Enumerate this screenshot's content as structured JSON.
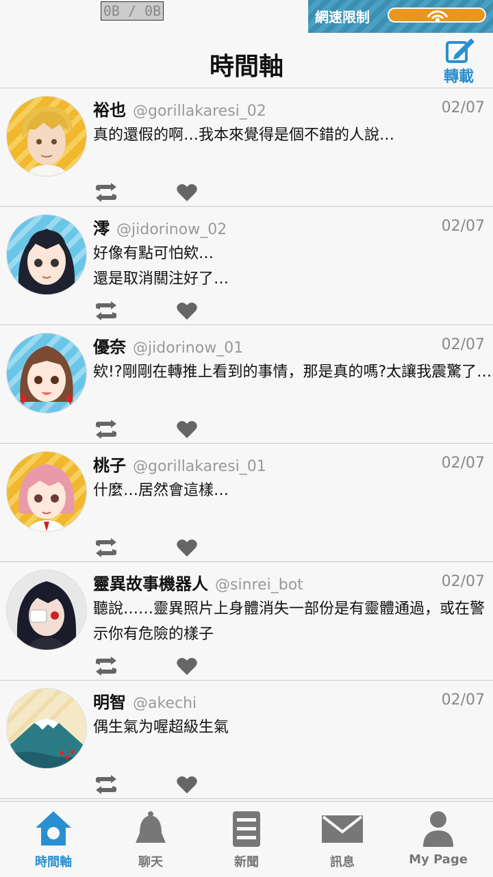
{
  "status": {
    "counter": "0B / 0B",
    "net_limit_label": "網速限制"
  },
  "header": {
    "title": "時間軸",
    "repost_label": "轉載"
  },
  "posts": [
    {
      "name": "裕也",
      "handle": "@gorillakaresi_02",
      "date": "02/07",
      "text": "真的還假的啊…我本來覺得是個不錯的人說…"
    },
    {
      "name": "澪",
      "handle": "@jidorinow_02",
      "date": "02/07",
      "text": "好像有點可怕欸…\n還是取消關注好了…"
    },
    {
      "name": "優奈",
      "handle": "@jidorinow_01",
      "date": "02/07",
      "text": "欸!?剛剛在轉推上看到的事情，那是真的嗎?太讓我震驚了…"
    },
    {
      "name": "桃子",
      "handle": "@gorillakaresi_01",
      "date": "02/07",
      "text": "什麼…居然會這樣…"
    },
    {
      "name": "靈異故事機器人",
      "handle": "@sinrei_bot",
      "date": "02/07",
      "text": "聽說……靈異照片上身體消失一部份是有靈體通過，或在警示你有危險的樣子"
    },
    {
      "name": "明智",
      "handle": "@akechi",
      "date": "02/07",
      "text": "偶生氣为喔超級生氣"
    }
  ],
  "nav": {
    "tabs": [
      {
        "label": "時間軸",
        "icon": "home-icon",
        "active": true
      },
      {
        "label": "聊天",
        "icon": "bell-icon"
      },
      {
        "label": "新聞",
        "icon": "news-icon"
      },
      {
        "label": "訊息",
        "icon": "mail-icon"
      },
      {
        "label": "My Page",
        "icon": "person-icon"
      }
    ]
  },
  "colors": {
    "accent": "#2a8fd0",
    "net_bar": "#e8961e",
    "net_bg": "#3b8fb0",
    "icon_gray": "#777777"
  }
}
